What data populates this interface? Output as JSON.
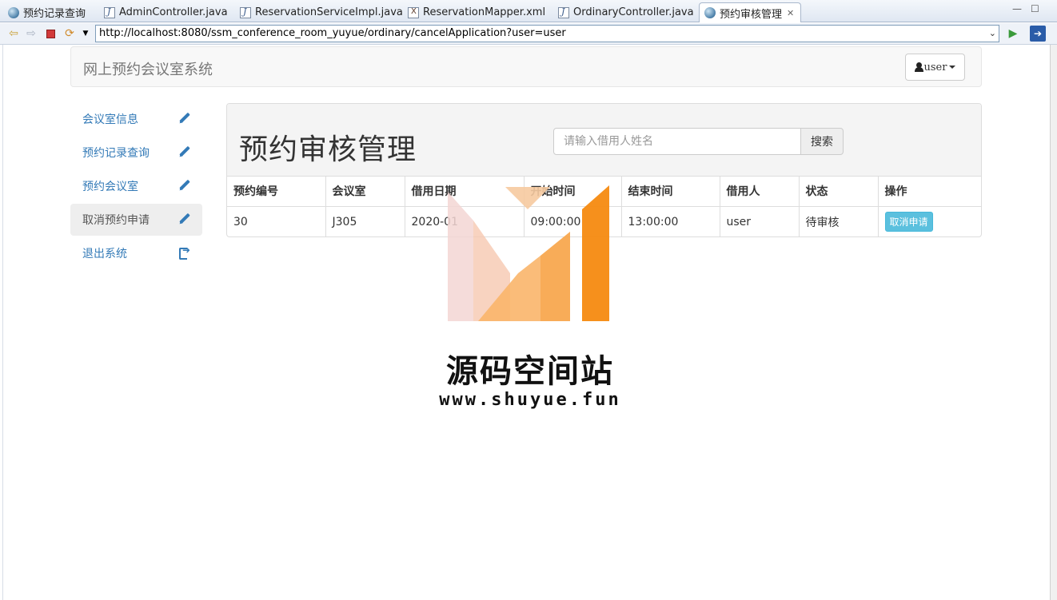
{
  "browser": {
    "tabs": [
      {
        "label": "预约记录查询",
        "icon": "globe-icon"
      },
      {
        "label": "AdminController.java",
        "icon": "java-file-icon"
      },
      {
        "label": "ReservationServiceImpl.java",
        "icon": "java-file-icon"
      },
      {
        "label": "ReservationMapper.xml",
        "icon": "xml-file-icon"
      },
      {
        "label": "OrdinaryController.java",
        "icon": "java-file-icon"
      },
      {
        "label": "预约审核管理",
        "icon": "globe-icon",
        "active": true,
        "close": "✕"
      }
    ],
    "url": "http://localhost:8080/ssm_conference_room_yuyue/ordinary/cancelApplication?user=user"
  },
  "navbar": {
    "brand": "网上预约会议室系统",
    "user_label": "user"
  },
  "sidebar": {
    "items": [
      {
        "label": "会议室信息",
        "icon": "pencil-icon"
      },
      {
        "label": "预约记录查询",
        "icon": "pencil-icon"
      },
      {
        "label": "预约会议室",
        "icon": "pencil-icon"
      },
      {
        "label": "取消预约申请",
        "icon": "pencil-icon",
        "active": true
      },
      {
        "label": "退出系统",
        "icon": "logout-icon"
      }
    ]
  },
  "main": {
    "title": "预约审核管理",
    "search": {
      "placeholder": "请输入借用人姓名",
      "button": "搜索"
    },
    "table": {
      "headers": [
        "预约编号",
        "会议室",
        "借用日期",
        "开始时间",
        "结束时间",
        "借用人",
        "状态",
        "操作"
      ],
      "rows": [
        {
          "id": "30",
          "room": "J305",
          "date": "2020-01",
          "start": "09:00:00",
          "end": "13:00:00",
          "borrower": "user",
          "status": "待审核",
          "action": "取消申请"
        }
      ]
    }
  },
  "watermark": {
    "name": "源码空间站",
    "url": "www.shuyue.fun"
  },
  "colors": {
    "link": "#337ab7",
    "info_button": "#5bc0de",
    "watermark_orange": "#f7931e",
    "watermark_pink": "#f3d6d4"
  }
}
